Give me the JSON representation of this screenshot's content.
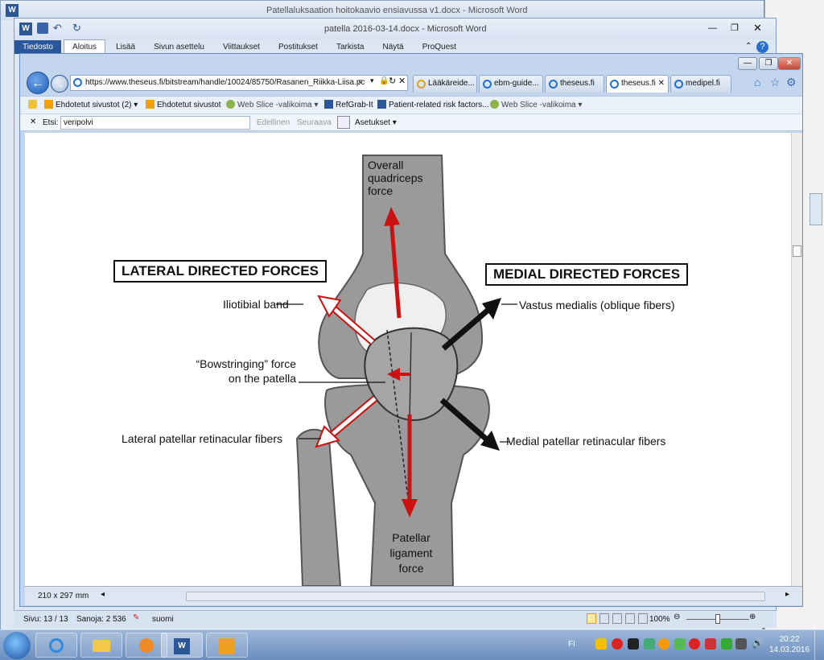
{
  "word_back": {
    "title": "Patellaluksaation hoitokaavio ensiavussa v1.docx - Microsoft Word"
  },
  "word_front": {
    "title": "patella 2016-03-14.docx - Microsoft Word",
    "ribbon_tabs": [
      "Tiedosto",
      "Aloitus",
      "Lisää",
      "Sivun asettelu",
      "Viittaukset",
      "Postitukset",
      "Tarkista",
      "Näytä",
      "ProQuest"
    ]
  },
  "ie": {
    "address": "https://www.theseus.fi/bitstream/handle/10024/85750/Rasanen_Riikka-Liisa.pc",
    "tabs": [
      {
        "label": "Lääkäreide...",
        "active": false
      },
      {
        "label": "ebm-guide...",
        "active": false
      },
      {
        "label": "theseus.fi",
        "active": false
      },
      {
        "label": "theseus.fi",
        "active": true
      },
      {
        "label": "medipel.fi",
        "active": false
      }
    ],
    "favorites": [
      "Ehdotetut sivustot (2)",
      "Ehdotetut sivustot",
      "Web Slice -valikoima",
      "RefGrab-It",
      "Patient-related risk factors...",
      "Web Slice -valikoima"
    ],
    "find": {
      "label": "Etsi:",
      "value": "veripolvi",
      "prev": "Edellinen",
      "next": "Seuraava",
      "options": "Asetukset"
    },
    "page_size": "210 x 297 mm"
  },
  "diagram": {
    "lateral_title": "LATERAL DIRECTED FORCES",
    "medial_title": "MEDIAL DIRECTED FORCES",
    "quadriceps": [
      "Overall",
      "quadriceps",
      "force"
    ],
    "iliotibial": "Iliotibial band",
    "bowstring": [
      "“Bowstringing” force",
      "on the patella"
    ],
    "lateral_retinacular": "Lateral patellar retinacular fibers",
    "vastus": "Vastus medialis (oblique fibers)",
    "medial_retinacular": "Medial patellar retinacular fibers",
    "patellar_ligament": [
      "Patellar",
      "ligament",
      "force"
    ]
  },
  "word_status": {
    "page": "Sivu: 13 / 13",
    "words": "Sanoja: 2 536",
    "language": "suomi",
    "zoom": "100%",
    "zoom_level": 0.5
  },
  "taskbar": {
    "lang": "FI",
    "time": "20:22",
    "date": "14.03.2016"
  },
  "colors": {
    "accent": "#2a579a",
    "red_arrow": "#cc1111"
  }
}
